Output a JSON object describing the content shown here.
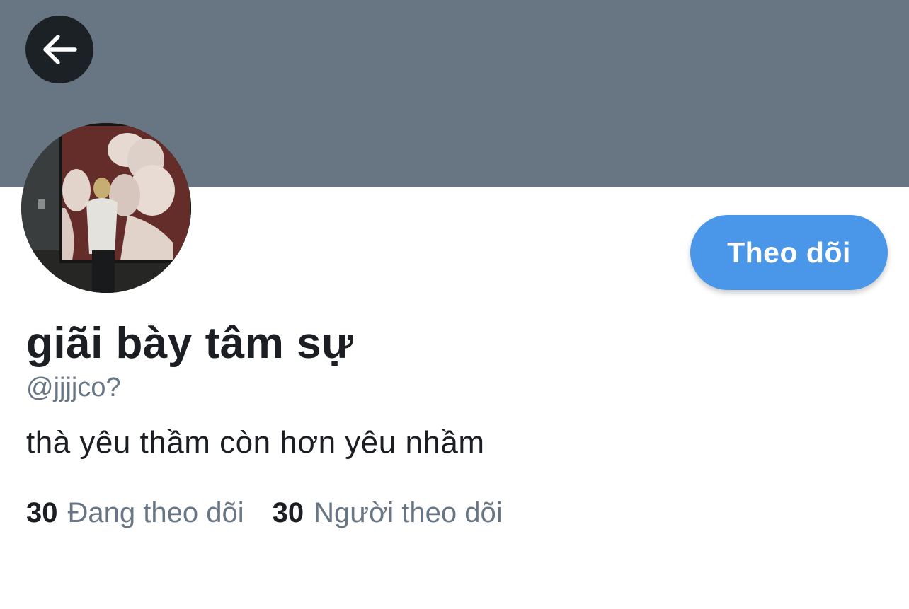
{
  "profile": {
    "display_name": "giãi bày tâm sự",
    "handle": "@jjjjco?",
    "bio": "thà yêu thầm còn hơn yêu nhầm",
    "follow_button_label": "Theo dõi",
    "following_count": "30",
    "following_label": "Đang theo dõi",
    "followers_count": "30",
    "followers_label": "Người theo dõi"
  },
  "icons": {
    "back": "arrow-left-icon"
  },
  "colors": {
    "banner": "#687684",
    "accent": "#4a97ea",
    "back_button_bg": "#1c2126",
    "primary_text": "#1b1f23",
    "secondary_text": "#687684"
  }
}
